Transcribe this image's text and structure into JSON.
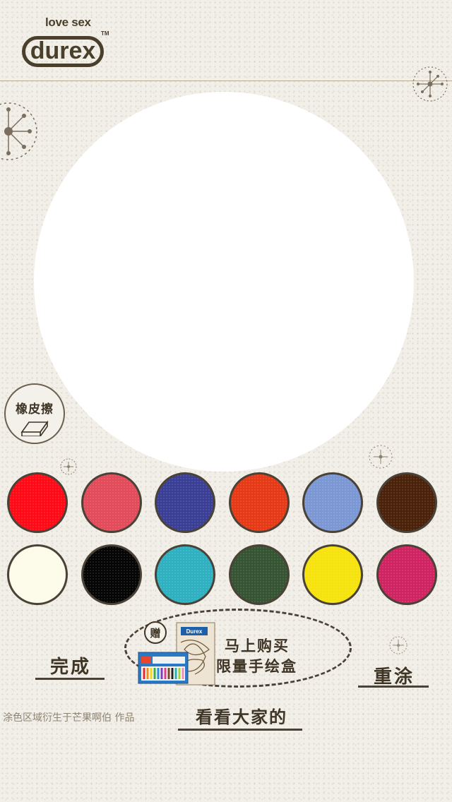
{
  "brand": {
    "tagline": "love sex",
    "name": "durex",
    "trademark": "TM"
  },
  "tools": {
    "eraser_label": "橡皮擦"
  },
  "palette": {
    "row1": [
      "#ff0a16",
      "#e24c5a",
      "#3a3f95",
      "#e63a16",
      "#7c98d4",
      "#4a220a"
    ],
    "row2": [
      "#fdfbea",
      "#050505",
      "#2fb0c0",
      "#355432",
      "#f6e20c",
      "#cf2461"
    ]
  },
  "actions": {
    "done": "完成",
    "redo": "重涂",
    "gallery": "看看大家的"
  },
  "promo": {
    "gift_label": "赠",
    "line1": "马上购买",
    "line2": "限量手绘盒",
    "pack_brand": "Durex"
  },
  "footer": {
    "credit": "涂色区域衍生于芒果啊伯 作品"
  }
}
